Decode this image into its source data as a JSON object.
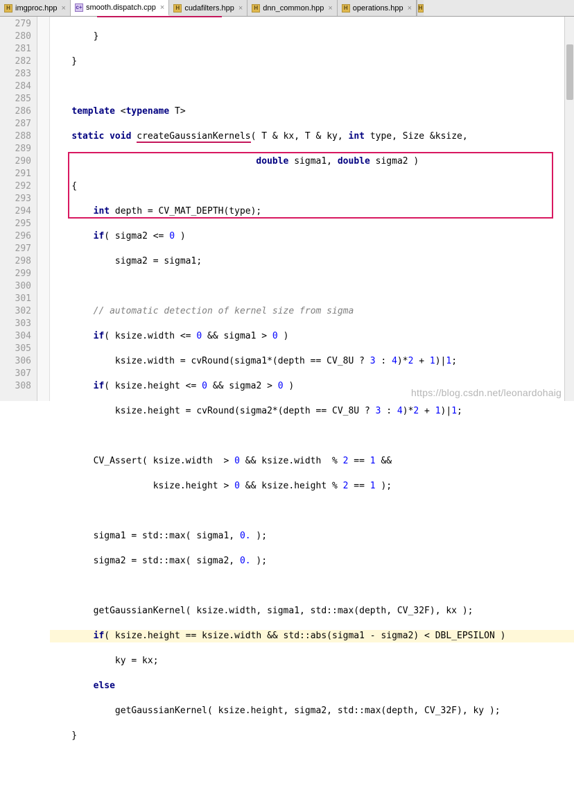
{
  "tabs": {
    "items": [
      {
        "label": "imgproc.hpp",
        "type": "h"
      },
      {
        "label": "smooth.dispatch.cpp",
        "type": "c"
      },
      {
        "label": "cudafilters.hpp",
        "type": "h"
      },
      {
        "label": "dnn_common.hpp",
        "type": "h"
      },
      {
        "label": "operations.hpp",
        "type": "h"
      }
    ],
    "active_index": 1,
    "close_glyph": "×"
  },
  "gutter": {
    "start": 279,
    "end": 308
  },
  "code": {
    "l279": "        }",
    "l280": "    }",
    "l281": "",
    "l282_pre": "    ",
    "l282_template": "template",
    "l282_lt": " <",
    "l282_typename": "typename",
    "l282_t": " T>",
    "l283_pre": "    ",
    "l283_static": "static",
    "l283_sp": " ",
    "l283_void": "void",
    "l283_sp2": " ",
    "l283_fn": "createGaussianKernels",
    "l283_args": "( T & kx, T & ky, ",
    "l283_int": "int",
    "l283_rest": " type, Size &ksize,",
    "l284_pre": "                                      ",
    "l284_double1": "double",
    "l284_s1": " sigma1, ",
    "l284_double2": "double",
    "l284_s2": " sigma2 )",
    "l285": "    {",
    "l286_pre": "        ",
    "l286_int": "int",
    "l286_rest": " depth = CV_MAT_DEPTH(type);",
    "l287_pre": "        ",
    "l287_if": "if",
    "l287_mid": "( sigma2 <= ",
    "l287_zero": "0",
    "l287_end": " )",
    "l288": "            sigma2 = sigma1;",
    "l289": "",
    "l290_pre": "        ",
    "l290_com": "// automatic detection of kernel size from sigma",
    "l291_pre": "        ",
    "l291_if": "if",
    "l291_mid": "( ksize.width <= ",
    "l291_z1": "0",
    "l291_and": " && sigma1 > ",
    "l291_z2": "0",
    "l291_end": " )",
    "l292_pre": "            ksize.width = cvRound(sigma1*(depth == CV_8U ? ",
    "l292_n3": "3",
    "l292_c1": " : ",
    "l292_n4": "4",
    "l292_c2": ")*",
    "l292_n2": "2",
    "l292_c3": " + ",
    "l292_n1": "1",
    "l292_c4": ")|",
    "l292_n1b": "1",
    "l292_end": ";",
    "l293_pre": "        ",
    "l293_if": "if",
    "l293_mid": "( ksize.height <= ",
    "l293_z1": "0",
    "l293_and": " && sigma2 > ",
    "l293_z2": "0",
    "l293_end": " )",
    "l294_pre": "            ksize.height = cvRound(sigma2*(depth == CV_8U ? ",
    "l294_n3": "3",
    "l294_c1": " : ",
    "l294_n4": "4",
    "l294_c2": ")*",
    "l294_n2": "2",
    "l294_c3": " + ",
    "l294_n1": "1",
    "l294_c4": ")|",
    "l294_n1b": "1",
    "l294_end": ";",
    "l295": "",
    "l296_pre": "        CV_Assert( ksize.width  > ",
    "l296_z": "0",
    "l296_mid": " && ksize.width  % ",
    "l296_n2": "2",
    "l296_eq": " == ",
    "l296_n1": "1",
    "l296_end": " &&",
    "l297_pre": "                   ksize.height > ",
    "l297_z": "0",
    "l297_mid": " && ksize.height % ",
    "l297_n2": "2",
    "l297_eq": " == ",
    "l297_n1": "1",
    "l297_end": " );",
    "l298": "",
    "l299_pre": "        sigma1 = std::max( sigma1, ",
    "l299_z": "0.",
    "l299_end": " );",
    "l300_pre": "        sigma2 = std::max( sigma2, ",
    "l300_z": "0.",
    "l300_end": " );",
    "l301": "",
    "l302": "        getGaussianKernel( ksize.width, sigma1, std::max(depth, CV_32F), kx );",
    "l303_pre": "        ",
    "l303_if": "if",
    "l303_rest": "( ksize.height == ksize.width && std::abs(sigma1 - sigma2) < DBL_EPSILON )",
    "l304": "            ky = kx;",
    "l305_pre": "        ",
    "l305_else": "else",
    "l306": "            getGaussianKernel( ksize.height, sigma2, std::max(depth, CV_32F), ky );",
    "l307": "    }",
    "l308": ""
  },
  "watermark": "https://blog.csdn.net/leonardohaig"
}
